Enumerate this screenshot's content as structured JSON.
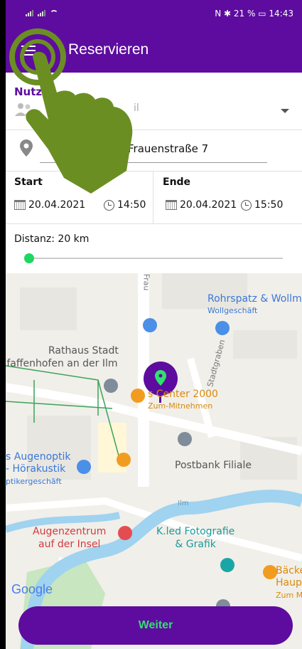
{
  "status": {
    "battery": "21 %",
    "time": "14:43",
    "bt": "N ✱"
  },
  "appbar": {
    "title": "Reservieren"
  },
  "form": {
    "user_label": "Nutzer",
    "user_placeholder": "il",
    "address": "Frauenstraße 7",
    "start_label": "Start",
    "end_label": "Ende",
    "start_date": "20.04.2021",
    "start_time": "14:50",
    "end_date": "20.04.2021",
    "end_time": "15:50",
    "distance": "Distanz: 20 km",
    "distance_value_fraction": 0.02
  },
  "map": {
    "pois": {
      "rohrspatz": "Rohrspatz & Wollm",
      "rohrspatz_sub": "Wollgeschäft",
      "rathaus1": "Rathaus Stadt",
      "rathaus2": "faffenhofen an der Ilm",
      "center": "s Center 2000",
      "center_sub": "Zum-Mitnehmen",
      "augenoptik1": "s Augenoptik",
      "augenoptik2": "- Hörakustik",
      "augenoptik_sub": "ptikergeschäft",
      "postbank": "Postbank Filiale",
      "augenzentrum1": "Augenzentrum",
      "augenzentrum2": "auf der Insel",
      "kled1": "K.led Fotografie",
      "kled2": "& Grafik",
      "baeck1": "Bäcke",
      "baeck2": "Haup",
      "baeck_sub": "Zum M",
      "street_stadtgraben": "Stadtgraben",
      "street_frau": "Frau",
      "river": "Ilm",
      "google": "Google"
    }
  },
  "actions": {
    "next": "Weiter"
  },
  "colors": {
    "primary": "#5d0c9f",
    "accent": "#32e06e",
    "hand": "#6b8e23"
  }
}
